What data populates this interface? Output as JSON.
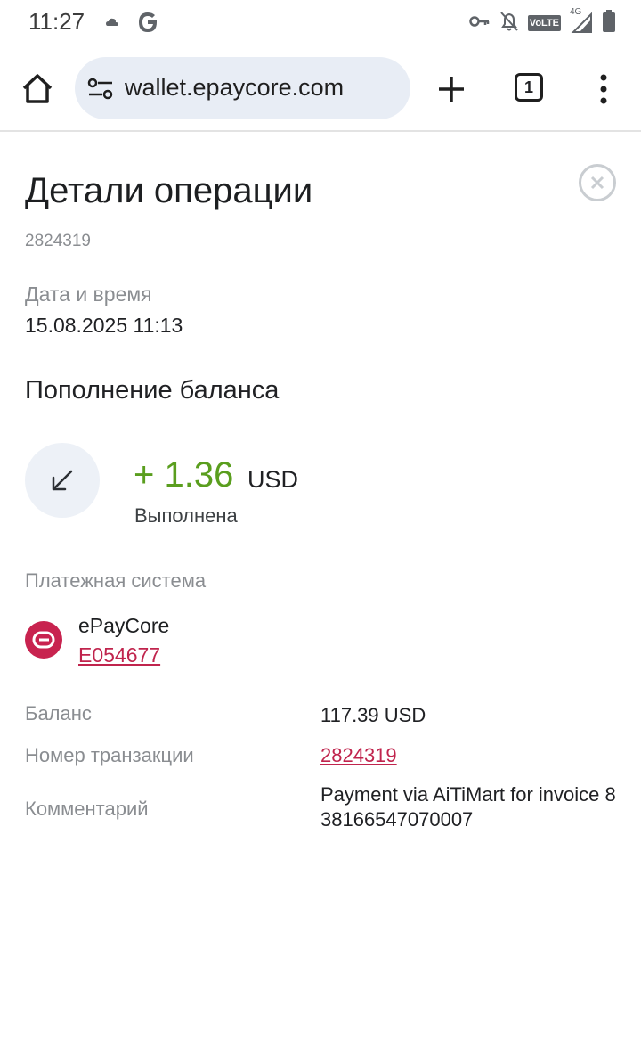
{
  "status_bar": {
    "time": "11:27",
    "icons": [
      "cloud-icon",
      "google-g-icon",
      "key-icon",
      "bell-off-icon",
      "volte-icon",
      "signal-4g-icon",
      "battery-icon"
    ],
    "volte_label": "VoLTE",
    "network_label": "4G"
  },
  "browser": {
    "url": "wallet.epaycore.com",
    "tab_count": "1"
  },
  "page": {
    "title": "Детали операции",
    "operation_id": "2824319",
    "datetime_label": "Дата и время",
    "datetime_value": "15.08.2025 11:13",
    "operation_type": "Пополнение баланса",
    "amount": "+ 1.36",
    "currency": "USD",
    "status": "Выполнена",
    "amount_color": "#5a9e1e"
  },
  "payment_system": {
    "label": "Платежная система",
    "name": "ePayCore",
    "account": "E054677",
    "brand_color": "#c8234f"
  },
  "details": {
    "balance_label": "Баланс",
    "balance_value": "117.39 USD",
    "txn_label": "Номер транзакции",
    "txn_value": "2824319",
    "comment_label": "Комментарий",
    "comment_value": "Payment via AiTiMart for invoice 838166547070007"
  }
}
